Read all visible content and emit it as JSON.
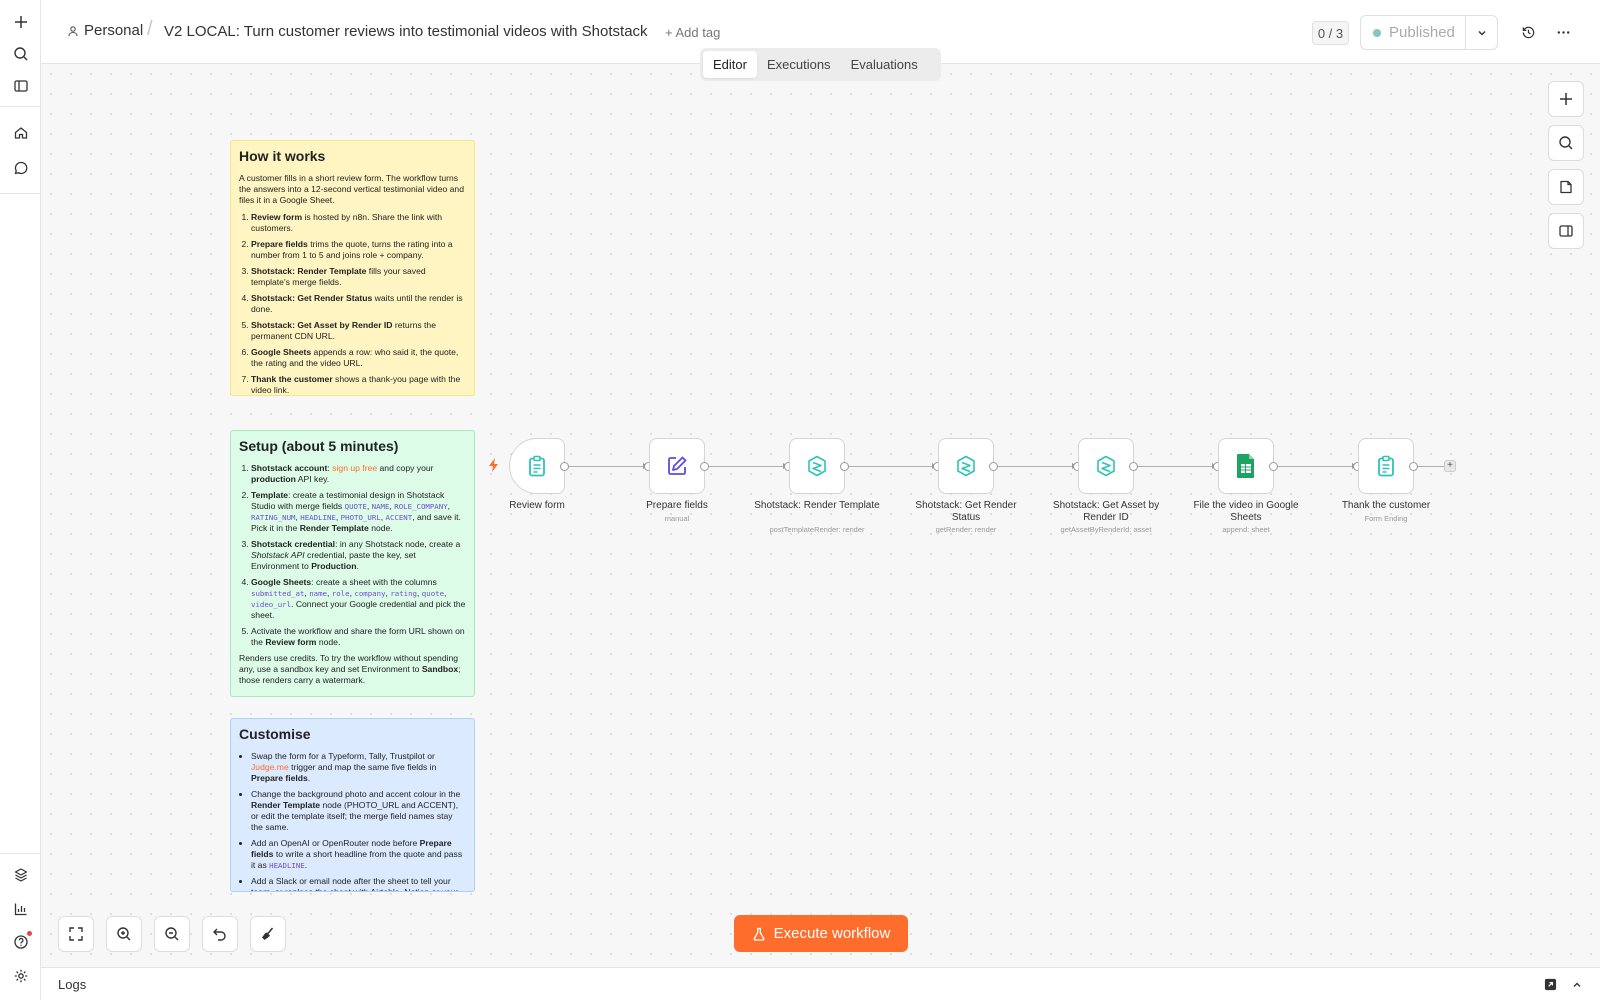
{
  "breadcrumb": {
    "project": "Personal",
    "separator": "/"
  },
  "workflow": {
    "title": "V2 LOCAL: Turn customer reviews into testimonial videos with Shotstack",
    "add_tag": "+ Add tag"
  },
  "header": {
    "counter": "0 / 3",
    "publish_label": "Published"
  },
  "tabs": [
    {
      "label": "Editor"
    },
    {
      "label": "Executions"
    },
    {
      "label": "Evaluations"
    }
  ],
  "notes": {
    "how": {
      "title": "How it works",
      "intro": "A customer fills in a short review form. The workflow turns the answers into a 12-second vertical testimonial video and files it in a Google Sheet.",
      "items": [
        {
          "bold": "Review form",
          "text": " is hosted by n8n. Share the link with customers."
        },
        {
          "bold": "Prepare fields",
          "text": " trims the quote, turns the rating into a number from 1 to 5 and joins role + company."
        },
        {
          "bold": "Shotstack: Render Template",
          "text": " fills your saved template's merge fields."
        },
        {
          "bold": "Shotstack: Get Render Status",
          "text": " waits until the render is done."
        },
        {
          "bold": "Shotstack: Get Asset by Render ID",
          "text": " returns the permanent CDN URL."
        },
        {
          "bold": "Google Sheets",
          "text": " appends a row: who said it, the quote, the rating and the video URL."
        },
        {
          "bold": "Thank the customer",
          "text": " shows a thank-you page with the video link."
        }
      ]
    },
    "setup": {
      "title": "Setup (about 5 minutes)",
      "s1_bold": "Shotstack account",
      "s1_a": ": ",
      "s1_link": "sign up free",
      "s1_b": " and copy your ",
      "s1_bold2": "production",
      "s1_c": " API key.",
      "s2_bold": "Template",
      "s2_a": ": create a testimonial design in Shotstack Studio with merge fields ",
      "s2_codes": [
        "QUOTE",
        "NAME",
        "ROLE_COMPANY",
        "RATING_NUM",
        "HEADLINE",
        "PHOTO_URL",
        "ACCENT"
      ],
      "s2_b": ", and save it. Pick it in the ",
      "s2_bold2": "Render Template",
      "s2_c": " node.",
      "s3_bold": "Shotstack credential",
      "s3_a": ": in any Shotstack node, create a ",
      "s3_italic": "Shotstack API",
      "s3_b": " credential, paste the key, set Environment to ",
      "s3_bold2": "Production",
      "s3_c": ".",
      "s4_bold": "Google Sheets",
      "s4_a": ": create a sheet with the columns ",
      "s4_codes": [
        "submitted_at",
        "name",
        "role",
        "company",
        "rating",
        "quote",
        "video_url"
      ],
      "s4_b": ". Connect your Google credential and pick the sheet.",
      "s5_a": "Activate the workflow and share the form URL shown on the ",
      "s5_bold": "Review form",
      "s5_b": " node.",
      "footer_a": "Renders use credits. To try the workflow without spending any, use a sandbox key and set Environment to ",
      "footer_bold": "Sandbox",
      "footer_b": "; those renders carry a watermark."
    },
    "custom": {
      "title": "Customise",
      "b1_a": "Swap the form for a Typeform, Tally, Trustpilot or ",
      "b1_link": "Judge.me",
      "b1_b": " trigger and map the same five fields in ",
      "b1_bold": "Prepare fields",
      "b1_c": ".",
      "b2_a": "Change the background photo and accent colour in the ",
      "b2_bold": "Render Template",
      "b2_b": " node (PHOTO_URL and ACCENT), or edit the template itself; the merge field names stay the same.",
      "b3_a": "Add an OpenAI or OpenRouter node before ",
      "b3_bold": "Prepare fields",
      "b3_b": " to write a short headline from the quote and pass it as ",
      "b3_code": "HEADLINE",
      "b3_c": ".",
      "b4": "Add a Slack or email node after the sheet to tell your team, or replace the sheet with Airtable, Notion or your CMS."
    }
  },
  "nodes": [
    {
      "label": "Review form",
      "sub": "",
      "icon": "clipboard-icon"
    },
    {
      "label": "Prepare fields",
      "sub": "manual",
      "icon": "pencil-icon"
    },
    {
      "label": "Shotstack: Render Template",
      "sub": "postTemplateRender: render",
      "icon": "shotstack-icon"
    },
    {
      "label": "Shotstack: Get Render Status",
      "sub": "getRender: render",
      "icon": "shotstack-icon"
    },
    {
      "label": "Shotstack: Get Asset by Render ID",
      "sub": "getAssetByRenderId: asset",
      "icon": "shotstack-icon"
    },
    {
      "label": "File the video in Google Sheets",
      "sub": "append: sheet",
      "icon": "google-sheets-icon"
    },
    {
      "label": "Thank the customer",
      "sub": "Form Ending",
      "icon": "clipboard-icon"
    }
  ],
  "execute": {
    "label": "Execute workflow"
  },
  "logs": {
    "label": "Logs"
  },
  "colors": {
    "accent": "#ff6d2d",
    "node_teal": "#2ec4b6",
    "node_violet": "#5b4de0",
    "sheets_green": "#1ea362",
    "code_purple": "#6d4dd6"
  }
}
